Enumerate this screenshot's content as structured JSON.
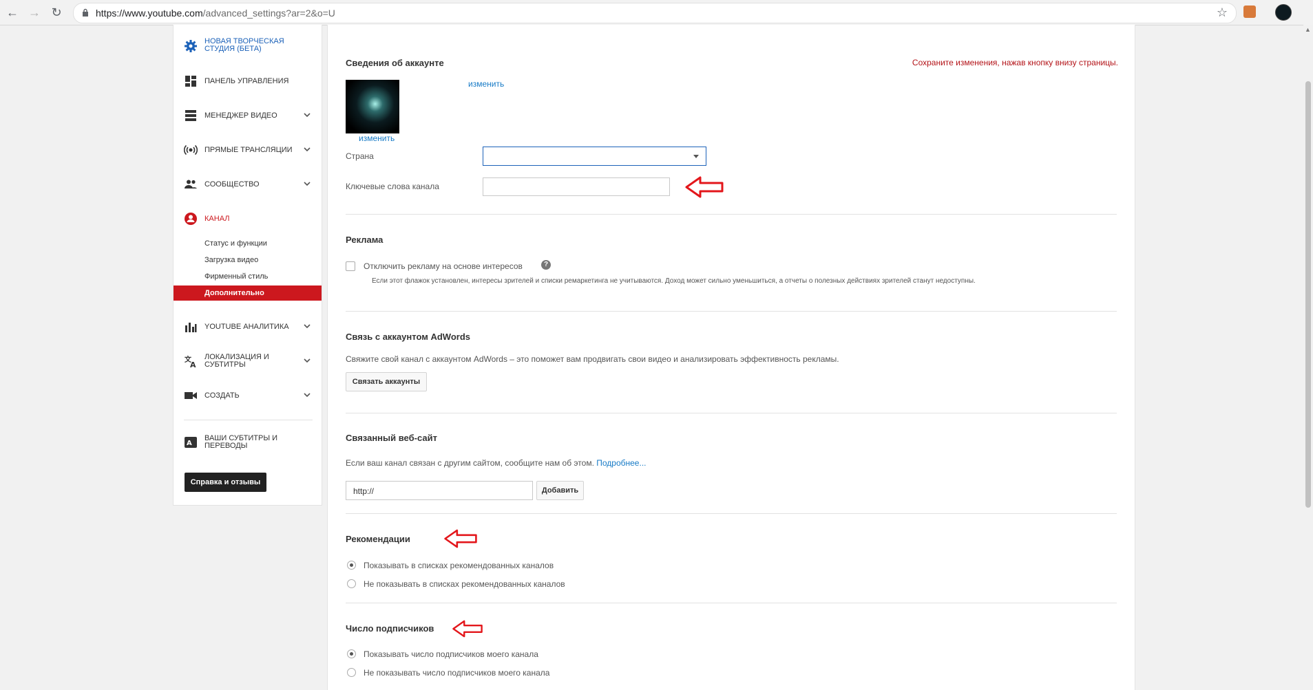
{
  "browser": {
    "url_host": "https://www.youtube.com",
    "url_path": "/advanced_settings?ar=2&o=U"
  },
  "sidebar": {
    "items": [
      {
        "label": "НОВАЯ ТВОРЧЕСКАЯ СТУДИЯ (БЕТА)"
      },
      {
        "label": "ПАНЕЛЬ УПРАВЛЕНИЯ"
      },
      {
        "label": "МЕНЕДЖЕР ВИДЕО"
      },
      {
        "label": "ПРЯМЫЕ ТРАНСЛЯЦИИ"
      },
      {
        "label": "СООБЩЕСТВО"
      },
      {
        "label": "КАНАЛ"
      },
      {
        "label": "YOUTUBE АНАЛИТИКА"
      },
      {
        "label": "ЛОКАЛИЗАЦИЯ И СУБТИТРЫ"
      },
      {
        "label": "СОЗДАТЬ"
      },
      {
        "label": "ВАШИ СУБТИТРЫ И ПЕРЕВОДЫ"
      }
    ],
    "channel_subitems": [
      "Статус и функции",
      "Загрузка видео",
      "Фирменный стиль",
      "Дополнительно"
    ],
    "help_button": "Справка и отзывы",
    "accent_color": "#cc181e"
  },
  "account": {
    "title": "Сведения об аккаунте",
    "save_note": "Сохраните изменения, нажав кнопку внизу страницы.",
    "change_link": "изменить",
    "avatar_change_link": "изменить",
    "country_label": "Страна",
    "keywords_label": "Ключевые слова канала",
    "keywords_value": ""
  },
  "ads": {
    "title": "Реклама",
    "checkbox_label": "Отключить рекламу на основе интересов",
    "help_icon": "question-icon",
    "description": "Если этот флажок установлен, интересы зрителей и списки ремаркетинга не учитываются. Доход может сильно уменьшиться, а отчеты о полезных действиях зрителей станут недоступны."
  },
  "adwords": {
    "title": "Связь с аккаунтом AdWords",
    "description": "Свяжите свой канал с аккаунтом AdWords – это поможет вам продвигать свои видео и анализировать эффективность рекламы.",
    "button": "Связать аккаунты"
  },
  "website": {
    "title": "Связанный веб-сайт",
    "description": "Если ваш канал связан с другим сайтом, сообщите нам об этом.",
    "more_link": "Подробнее...",
    "input_value": "http://",
    "add_button": "Добавить"
  },
  "recommendations": {
    "title": "Рекомендации",
    "options": [
      "Показывать в списках рекомендованных каналов",
      "Не показывать в списках рекомендованных каналов"
    ],
    "selected": 0
  },
  "subscribers": {
    "title": "Число подписчиков",
    "options": [
      "Показывать число подписчиков моего канала",
      "Не показывать число подписчиков моего канала"
    ],
    "selected": 0
  },
  "annotation_color": "#e3161b"
}
